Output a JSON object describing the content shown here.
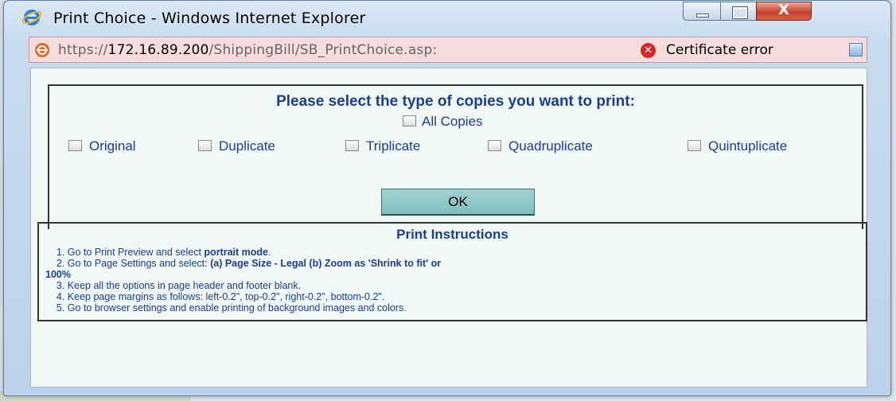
{
  "window": {
    "title": "Print Choice - Windows Internet Explorer"
  },
  "address_bar": {
    "url_prefix": "https://",
    "url_host": "172.16.89.200",
    "url_path": "/ShippingBill/SB_PrintChoice.asp:",
    "certificate_error": "Certificate error",
    "background_color": "#f6dcdc"
  },
  "form": {
    "heading": "Please select the type of copies you want to print:",
    "all_copies_label": "All Copies",
    "options": [
      "Original",
      "Duplicate",
      "Triplicate",
      "Quadruplicate",
      "Quintuplicate"
    ],
    "ok_label": "OK",
    "text_color": "#1d3d8f"
  },
  "instructions": {
    "title": "Print Instructions",
    "line1_prefix": "1. Go to Print Preview and select ",
    "line1_bold": "portrait mode",
    "line1_suffix": ".",
    "line2_prefix": "2. Go to Page Settings and select: ",
    "line2_bold": "(a) Page Size - Legal (b) Zoom as 'Shrink to fit' or",
    "line2_cont": "100%",
    "line3": "3. Keep all the options in page header and footer blank.",
    "line4": "4. Keep page margins as follows: left-0.2\", top-0.2\", right-0.2\", bottom-0.2\".",
    "line5": "5. Go to browser settings and enable printing of background images and colors."
  },
  "icons": {
    "ie": "internet-explorer-logo",
    "page": "site-icon",
    "cert": "certificate-error-icon",
    "compat": "compatibility-view-icon"
  }
}
